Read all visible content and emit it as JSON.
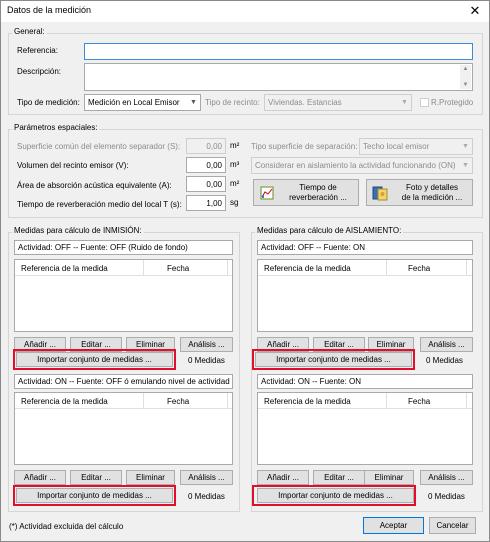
{
  "window": {
    "title": "Datos de la medición",
    "close_glyph": "✕"
  },
  "general": {
    "group_label": "General:",
    "referencia_label": "Referencia:",
    "referencia_value": "",
    "descripcion_label": "Descripción:",
    "descripcion_value": "",
    "tipo_medicion_label": "Tipo de medición:",
    "tipo_medicion_value": "Medición en Local Emisor",
    "tipo_recinto_label": "Tipo de recinto:",
    "tipo_recinto_value": "Viviendas. Estancias",
    "r_protegido_label": "R.Protegido"
  },
  "espaciales": {
    "group_label": "Parámetros espaciales:",
    "superficie_label": "Superficie común del elemento separador (S):",
    "superficie_value": "0,00",
    "superficie_unit": "m²",
    "tipo_superficie_label": "Tipo superficie de separación:",
    "tipo_superficie_value": "Techo local emisor",
    "volumen_label": "Volumen del recinto emisor (V):",
    "volumen_value": "0,00",
    "volumen_unit": "m³",
    "considerar_value": "Considerar en aislamiento la actividad funcionando (ON)",
    "area_label": "Área de absorción acústica equivalente (A):",
    "area_value": "0,00",
    "area_unit": "m²",
    "tiempo_label": "Tiempo de reverberación medio del local T (s):",
    "tiempo_value": "1,00",
    "tiempo_unit": "sg",
    "btn_tiempo_line1": "Tiempo de",
    "btn_tiempo_line2": "reverberación ...",
    "btn_foto_line1": "Foto y detalles",
    "btn_foto_line2": "de la medición ..."
  },
  "inmision": {
    "group_label": "Medidas para cálculo de INMISIÓN:",
    "top": {
      "activity": "Actividad: OFF -- Fuente: OFF  (Ruido de fondo)",
      "col_ref": "Referencia de la medida",
      "col_fecha": "Fecha",
      "btn_add": "Añadir ...",
      "btn_edit": "Editar ...",
      "btn_del": "Eliminar",
      "btn_analysis": "Análisis ...",
      "btn_import": "Importar conjunto de medidas ...",
      "count": "0 Medidas"
    },
    "bottom": {
      "activity": "Actividad: ON -- Fuente: OFF ó emulando nivel de actividad",
      "col_ref": "Referencia de la medida",
      "col_fecha": "Fecha",
      "btn_add": "Añadir ...",
      "btn_edit": "Editar ...",
      "btn_del": "Eliminar",
      "btn_analysis": "Análisis ...",
      "btn_import": "Importar conjunto de medidas ...",
      "count": "0 Medidas"
    }
  },
  "aislamiento": {
    "group_label": "Medidas para cálculo de AISLAMIENTO:",
    "top": {
      "activity": "Actividad: OFF -- Fuente: ON",
      "col_ref": "Referencia de la medida",
      "col_fecha": "Fecha",
      "btn_add": "Añadir ...",
      "btn_edit": "Editar ...",
      "btn_del": "Eliminar",
      "btn_analysis": "Análisis ...",
      "btn_import": "Importar conjunto de medidas ...",
      "count": "0 Medidas"
    },
    "bottom": {
      "activity": "Actividad: ON -- Fuente: ON",
      "col_ref": "Referencia de la medida",
      "col_fecha": "Fecha",
      "btn_add": "Añadir ...",
      "btn_edit": "Editar ...",
      "btn_del": "Eliminar",
      "btn_analysis": "Análisis ...",
      "btn_import": "Importar conjunto de medidas ...",
      "count": "0 Medidas"
    }
  },
  "footer": {
    "note": "(*) Actividad excluida del cálculo",
    "accept": "Aceptar",
    "cancel": "Cancelar"
  },
  "colors": {
    "highlight": "#e0102a",
    "accent": "#0078d7"
  }
}
